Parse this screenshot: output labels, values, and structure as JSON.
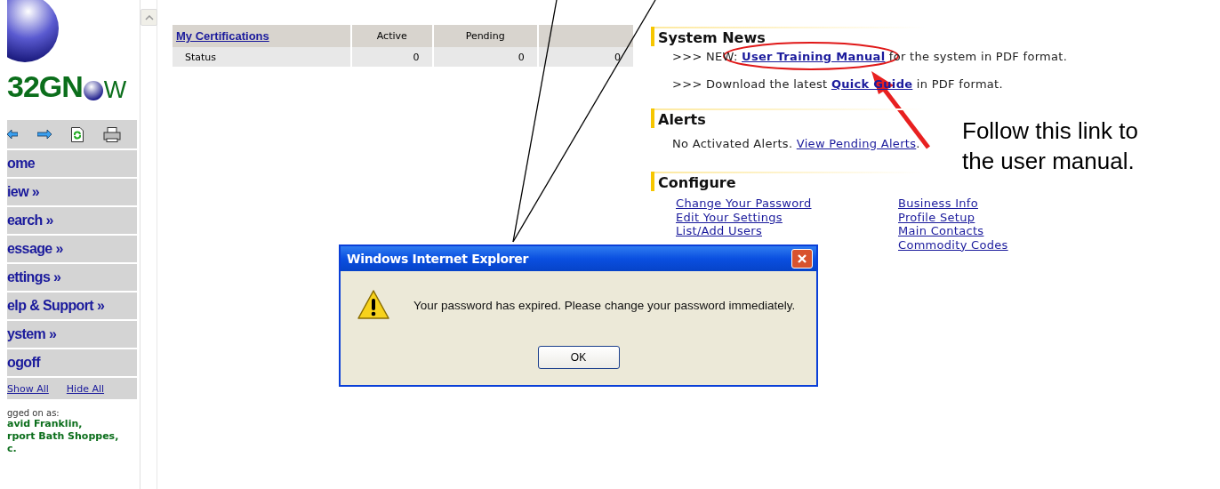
{
  "logo": {
    "text_start": "32GN",
    "text_end": "W"
  },
  "nav_menu": [
    "ome",
    "iew »",
    "earch »",
    "essage »",
    "ettings »",
    "elp & Support »",
    "ystem »",
    "ogoff"
  ],
  "expand_links": [
    "Show All",
    "Hide All"
  ],
  "logged_on": {
    "caption": "gged on as:",
    "lines": [
      "avid Franklin,",
      "rport Bath Shoppes,",
      "c."
    ]
  },
  "certifications": {
    "columns": [
      "My Certifications",
      "Active",
      "Pending",
      ""
    ],
    "rows": [
      {
        "cells": [
          "Status",
          "0",
          "0",
          "0"
        ]
      }
    ]
  },
  "system_news": {
    "title": "System News",
    "items": [
      {
        "before": ">>> NEW: ",
        "link": "User Training Manual",
        "after": " for the system in PDF format."
      },
      {
        "before": ">>> Download the latest ",
        "link": "Quick Guide",
        "after": " in PDF format."
      }
    ]
  },
  "alerts": {
    "title": "Alerts",
    "text": "No Activated Alerts. ",
    "link": "View Pending Alerts",
    "after": "."
  },
  "configure": {
    "title": "Configure",
    "columns": [
      [
        "Change Your Password",
        "Edit Your Settings",
        "List/Add Users"
      ],
      [
        "Business Info",
        "Profile Setup",
        "Main Contacts",
        "Commodity Codes"
      ]
    ]
  },
  "dialog": {
    "title": "Windows Internet Explorer",
    "message": "Your password has expired.  Please change your password immediately.",
    "buttons": [
      "OK"
    ]
  },
  "callout": {
    "lines": [
      "Follow this link to",
      "the user manual."
    ]
  }
}
